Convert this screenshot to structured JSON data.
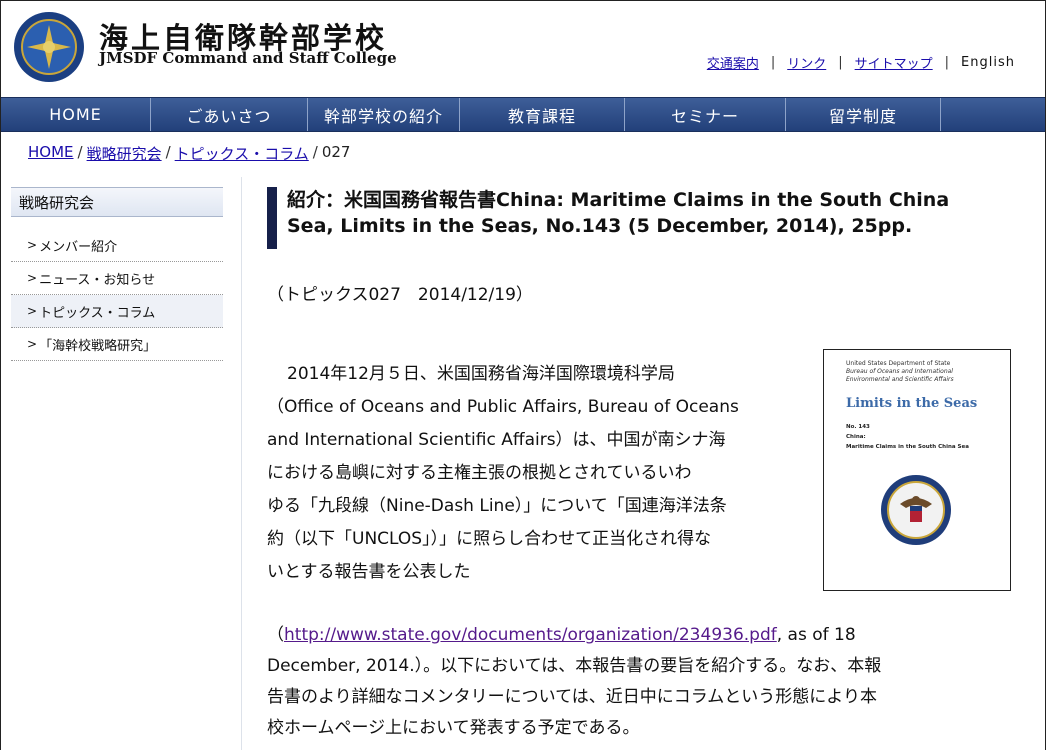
{
  "header": {
    "title_jp": "海上自衛隊幹部学校",
    "title_en": "JMSDF Command and Staff College",
    "util_links": [
      "交通案内",
      "リンク",
      "サイトマップ"
    ],
    "english_label": "English",
    "separator": "|"
  },
  "nav": {
    "items": [
      "HOME",
      "ごあいさつ",
      "幹部学校の紹介",
      "教育課程",
      "セミナー",
      "留学制度"
    ]
  },
  "breadcrumb": {
    "items": [
      "HOME",
      "戦略研究会",
      "トピックス・コラム"
    ],
    "current": "027",
    "separator": "/"
  },
  "sidebar": {
    "title": "戦略研究会",
    "items": [
      {
        "label": "メンバー紹介"
      },
      {
        "label": "ニュース・お知らせ"
      },
      {
        "label": "トピックス・コラム"
      },
      {
        "label": "「海幹校戦略研究」"
      }
    ],
    "chevron": ">"
  },
  "article": {
    "headline_line1": "紹介：米国国務省報告書China: Maritime Claims in the South China",
    "headline_line2": "Sea, Limits in the Seas, No.143 (5 December, 2014), 25pp.",
    "topic": "（トピックス027　2014/12/19）",
    "para1_lines": [
      "2014年12月５日、米国国務省海洋国際環境科学局",
      "（Office of Oceans and Public Affairs, Bureau of Oceans",
      "and International Scientific Affairs）は、中国が南シナ海",
      "における島嶼に対する主権主張の根拠とされているいわ",
      "ゆる「九段線（Nine-Dash Line）」について「国連海洋法条",
      "約（以下「UNCLOS」）」に照らし合わせて正当化され得な",
      "いとする報告書を公表した"
    ],
    "para2_open": "（",
    "para2_link": "http://www.state.gov/documents/organization/234936.pdf",
    "para2_after_link": ", as of 18",
    "para2_lines": [
      "December, 2014.）。以下においては、本報告書の要旨を紹介する。なお、本報",
      "告書のより詳細なコメンタリーについては、近日中にコラムという形態により本",
      "校ホームページ上において発表する予定である。"
    ]
  },
  "report_cover": {
    "dept": "United States Department of State",
    "bureau_line1": "Bureau of Oceans and International",
    "bureau_line2": "Environmental and Scientific Affairs",
    "title": "Limits in the Seas",
    "number": "No. 143",
    "country": "China:",
    "subject": "Maritime Claims in the South China Sea"
  },
  "colors": {
    "nav": "#2b4a86",
    "link": "#1a0dab",
    "visited": "#551a8b",
    "headline_bar": "#16204a"
  }
}
